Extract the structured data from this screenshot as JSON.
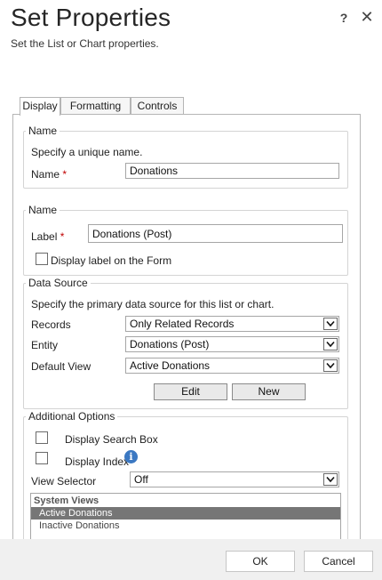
{
  "header": {
    "title": "Set Properties",
    "subtitle": "Set the List or Chart properties.",
    "help_label": "?",
    "close_label": "✕"
  },
  "tabs": [
    {
      "label": "Display",
      "active": true
    },
    {
      "label": "Formatting",
      "active": false
    },
    {
      "label": "Controls",
      "active": false
    }
  ],
  "name_section": {
    "legend": "Name",
    "hint": "Specify a unique name.",
    "field_label": "Name",
    "required_mark": "*",
    "value": "Donations"
  },
  "label_section": {
    "legend": "Name",
    "field_label": "Label",
    "required_mark": "*",
    "value": "Donations (Post)",
    "checkbox_label": "Display label on the Form",
    "checkbox_checked": false
  },
  "data_source": {
    "legend": "Data Source",
    "hint": "Specify the primary data source for this list or chart.",
    "records_label": "Records",
    "records_value": "Only Related Records",
    "entity_label": "Entity",
    "entity_value": "Donations (Post)",
    "default_view_label": "Default View",
    "default_view_value": "Active Donations",
    "edit_label": "Edit",
    "new_label": "New"
  },
  "additional_options": {
    "legend": "Additional Options",
    "search_box_label": "Display Search Box",
    "search_box_checked": false,
    "index_label": "Display Index",
    "index_checked": false,
    "info_icon": "info-icon",
    "view_selector_label": "View Selector",
    "view_selector_value": "Off",
    "views_header": "System Views",
    "views": [
      {
        "label": "Active Donations",
        "selected": true
      },
      {
        "label": "Inactive Donations",
        "selected": false
      }
    ]
  },
  "footer": {
    "ok_label": "OK",
    "cancel_label": "Cancel"
  },
  "colors": {
    "required": "#c00000",
    "selected_row": "#767676",
    "info": "#3b78c2",
    "footer_bg": "#f0f0f0"
  }
}
